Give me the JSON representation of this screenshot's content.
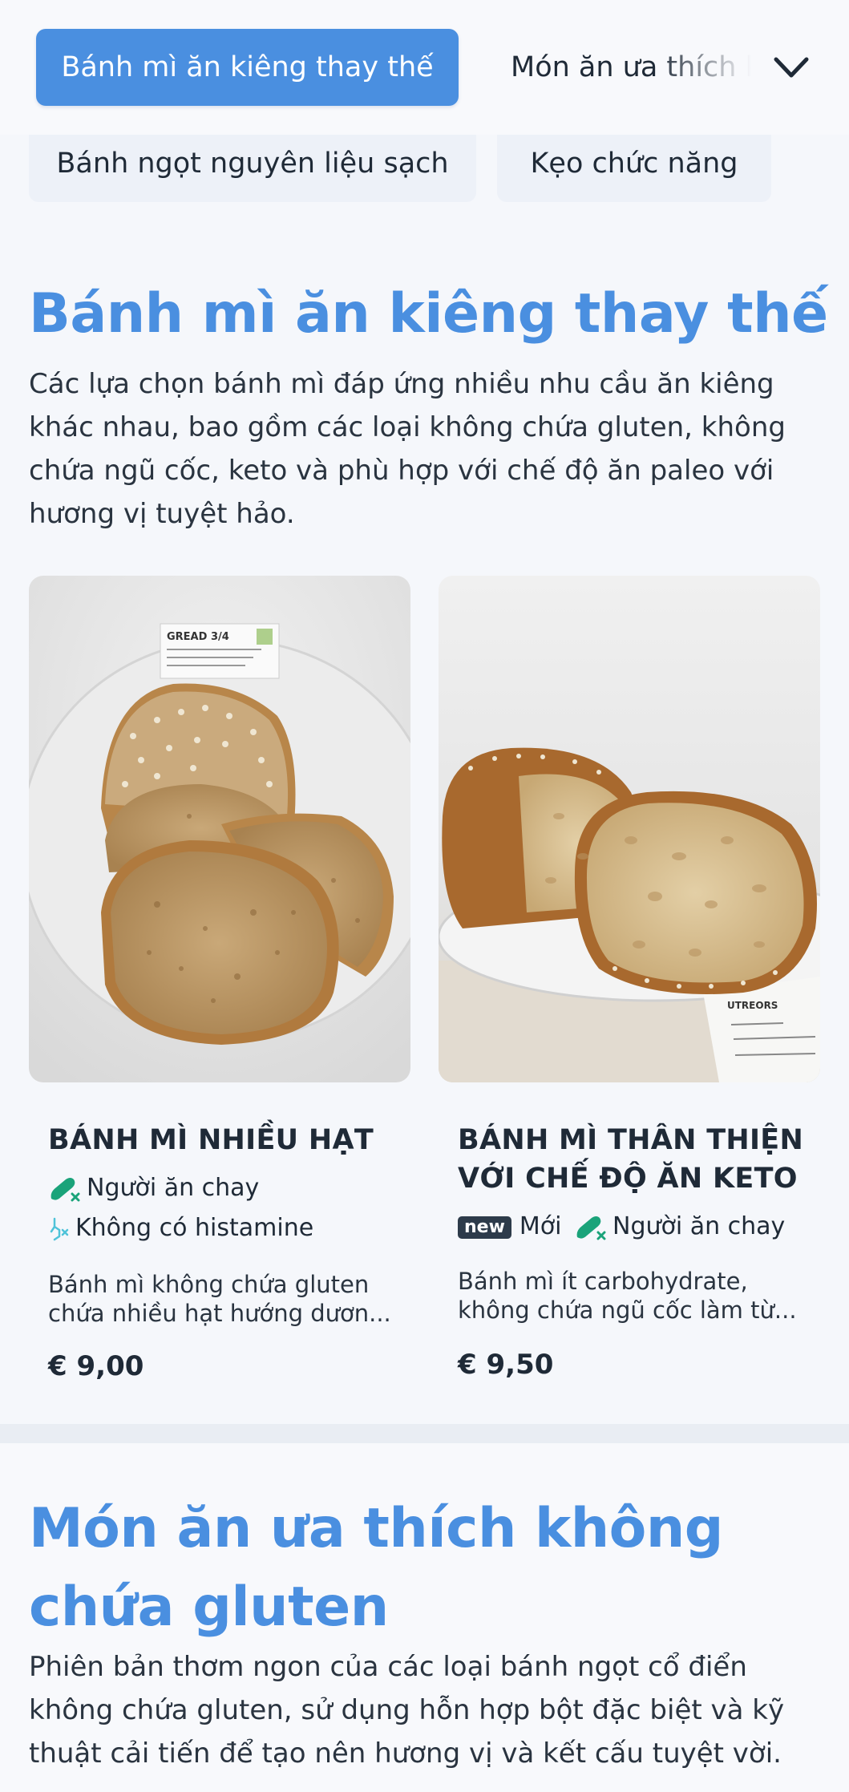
{
  "tabs": {
    "active": "Bánh mì ăn kiêng thay thế",
    "next": "Món ăn ưa thích không chứa gluten",
    "chips": [
      "Bánh ngọt nguyên liệu sạch",
      "Kẹo chức năng"
    ]
  },
  "section1": {
    "title": "Bánh mì ăn kiêng thay thế",
    "description": "Các lựa chọn bánh mì đáp ứng nhiều nhu cầu ăn kiêng khác nhau, bao gồm các loại không chứa gluten, không chứa ngũ cốc, keto và phù hợp với chế độ ăn paleo với hương vị tuyệt hảo."
  },
  "products": [
    {
      "title": "BÁNH MÌ NHIỀU HẠT",
      "tags": [
        "Người ăn chay",
        "Không có histamine"
      ],
      "description_line1": "Bánh mì không chứa gluten",
      "description_line2": "chứa nhiều hạt hướng dươn...",
      "price": "€ 9,00",
      "label_text": "GREAD  3/4"
    },
    {
      "title_line1": "BÁNH MÌ THÂN THIỆN",
      "title_line2": "VỚI CHẾ ĐỘ ĂN KETO",
      "badge": "new",
      "tags": [
        "Mới",
        "Người ăn chay"
      ],
      "description_line1": "Bánh mì ít carbohydrate,",
      "description_line2": "không chứa ngũ cốc làm từ...",
      "price": "€ 9,50",
      "label_text": "UTREORS"
    }
  ],
  "section2": {
    "title_line1": "Món ăn ưa thích không",
    "title_line2": "chứa gluten",
    "description": "Phiên bản thơm ngon của các loại bánh ngọt cổ điển không chứa gluten, sử dụng hỗn hợp bột đặc biệt và kỹ thuật cải tiến để tạo nên hương vị và kết cấu tuyệt vời."
  },
  "colors": {
    "accent": "#4a8fe0",
    "vegan_icon": "#1aa37a",
    "histamine_icon": "#4fc3d9"
  },
  "icons": {
    "chevron": "chevron-down-icon",
    "vegan": "leaf-drumstick-icon",
    "histamine": "histamine-free-icon"
  }
}
